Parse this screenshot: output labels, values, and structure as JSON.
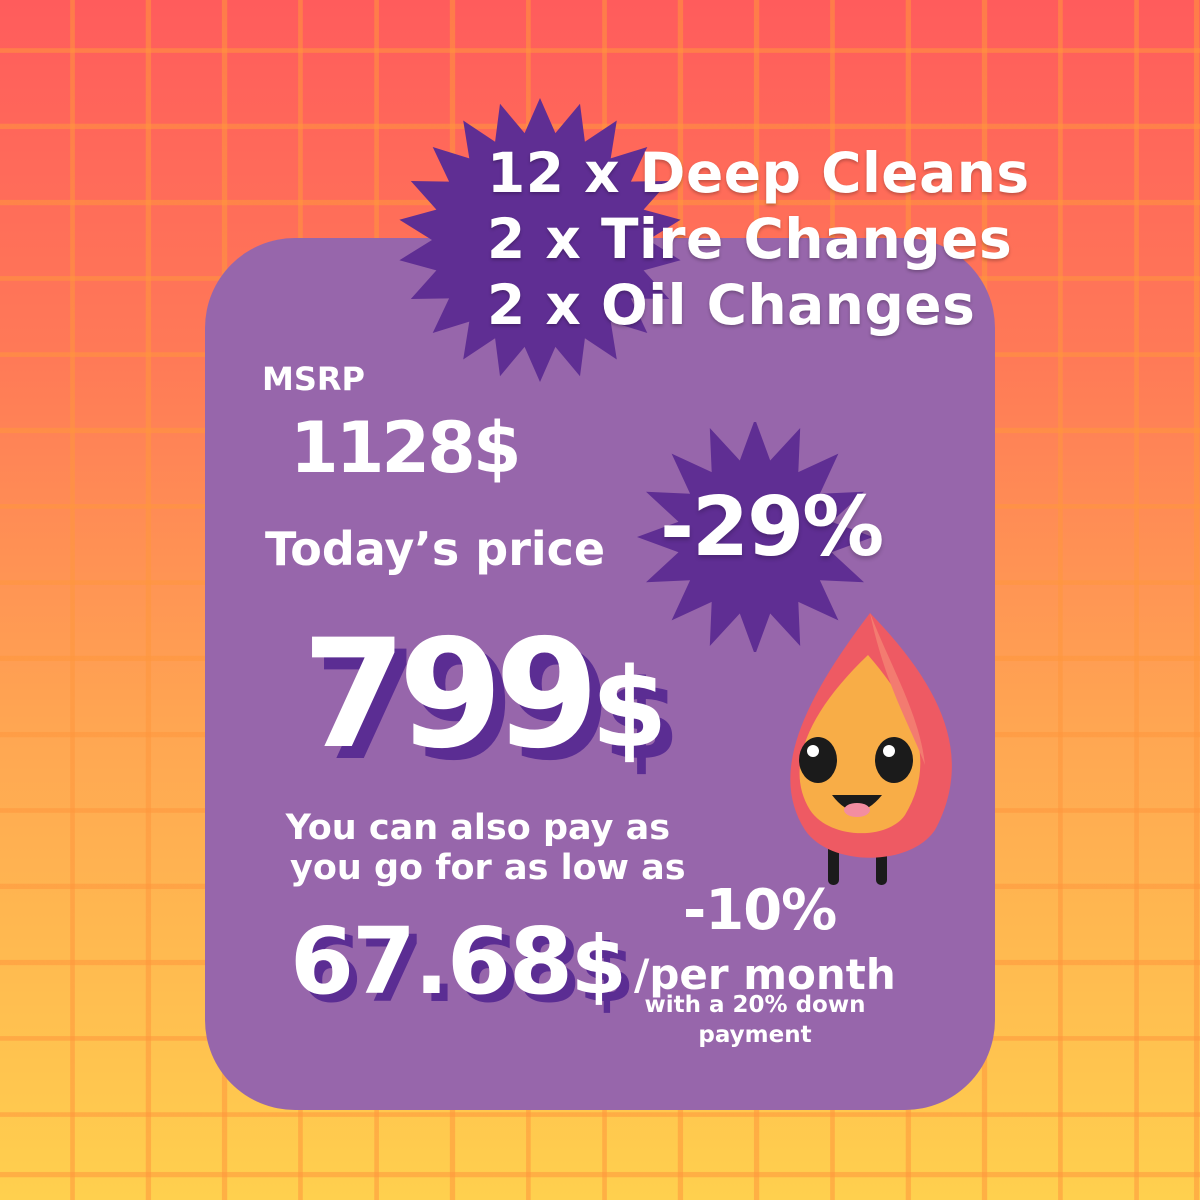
{
  "colors": {
    "background_top": "#ff5c5c",
    "background_bottom": "#ffd04e",
    "card": "#9766ab",
    "burst": "#5f2e93",
    "shadow": "#5b2d93",
    "text": "#ffffff"
  },
  "bundle": {
    "lines": [
      "12 x Deep Cleans",
      "2 x Tire Changes",
      "2 x Oil Changes"
    ]
  },
  "pricing": {
    "msrp_label": "MSRP",
    "msrp_value": "1128$",
    "today_label": "Today’s price",
    "discount_badge": "-29%",
    "today_value": "799",
    "today_currency": "$"
  },
  "installments": {
    "intro_line1": "You can also pay as",
    "intro_line2": "you go for as low as",
    "monthly_value": "67.68",
    "monthly_currency": "$",
    "discount": "-10%",
    "per_month": "/per month",
    "down_payment_line1": "with a 20% down",
    "down_payment_line2": "payment"
  },
  "mascot": {
    "icon": "flame-mascot-icon"
  }
}
